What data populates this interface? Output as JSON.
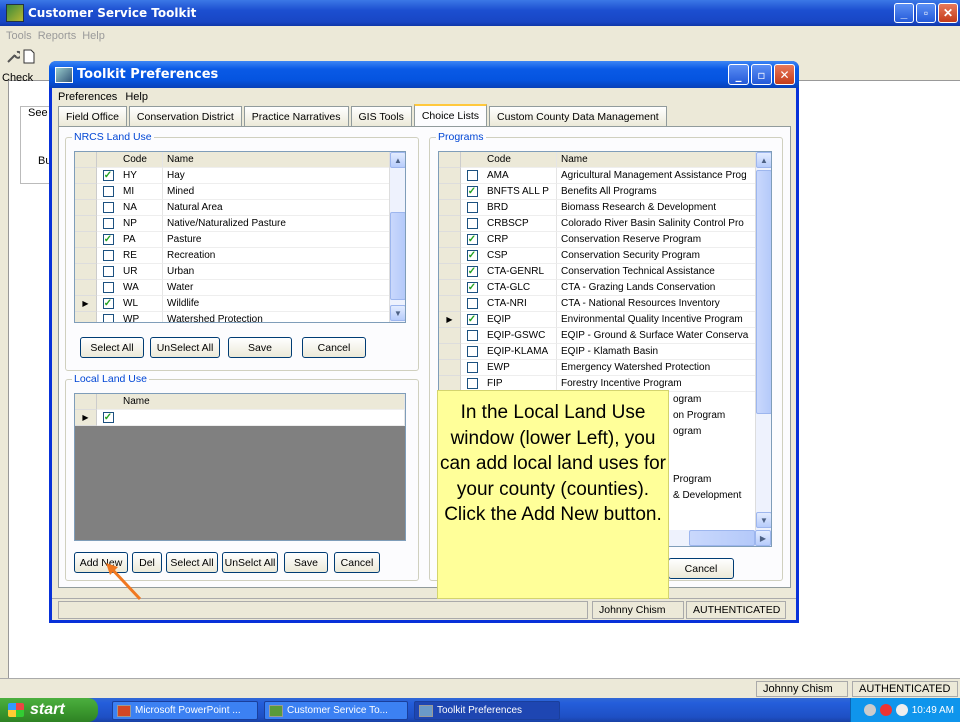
{
  "app": {
    "title": "Customer Service Toolkit",
    "menu": [
      "Tools",
      "Reports",
      "Help"
    ],
    "bg_fragments": {
      "check": "Check",
      "see": "See",
      "bu": "Bu"
    },
    "status_user": "Johnny Chism",
    "status_auth": "AUTHENTICATED"
  },
  "dialog": {
    "title": "Toolkit Preferences",
    "menu": [
      "Preferences",
      "Help"
    ],
    "tabs": [
      "Field Office",
      "Conservation District",
      "Practice Narratives",
      "GIS Tools",
      "Choice Lists",
      "Custom County Data Management"
    ],
    "active_tab": "Choice Lists",
    "nrcs": {
      "legend": "NRCS Land Use",
      "columns": [
        "Code",
        "Name"
      ],
      "rows": [
        {
          "checked": true,
          "code": "HY",
          "name": "Hay"
        },
        {
          "checked": false,
          "code": "MI",
          "name": "Mined"
        },
        {
          "checked": false,
          "code": "NA",
          "name": "Natural Area"
        },
        {
          "checked": false,
          "code": "NP",
          "name": "Native/Naturalized Pasture"
        },
        {
          "checked": true,
          "code": "PA",
          "name": "Pasture"
        },
        {
          "checked": false,
          "code": "RE",
          "name": "Recreation"
        },
        {
          "checked": false,
          "code": "UR",
          "name": "Urban"
        },
        {
          "checked": false,
          "code": "WA",
          "name": "Water"
        },
        {
          "checked": true,
          "code": "WL",
          "name": "Wildlife",
          "current": true
        },
        {
          "checked": false,
          "code": "WP",
          "name": "Watershed Protection"
        }
      ],
      "buttons": {
        "select_all": "Select All",
        "unselect_all": "UnSelect All",
        "save": "Save",
        "cancel": "Cancel"
      }
    },
    "local": {
      "legend": "Local Land Use",
      "columns": [
        "Name"
      ],
      "buttons": {
        "add_new": "Add New",
        "del": "Del",
        "select_all": "Select All",
        "unselect_all": "UnSelct All",
        "save": "Save",
        "cancel": "Cancel"
      }
    },
    "programs": {
      "legend": "Programs",
      "columns": [
        "Code",
        "Name"
      ],
      "rows": [
        {
          "checked": false,
          "code": "AMA",
          "name": "Agricultural Management Assistance Prog"
        },
        {
          "checked": true,
          "code": "BNFTS ALL P",
          "name": "Benefits All Programs"
        },
        {
          "checked": false,
          "code": "BRD",
          "name": "Biomass Research & Development"
        },
        {
          "checked": false,
          "code": "CRBSCP",
          "name": "Colorado River Basin Salinity Control Pro"
        },
        {
          "checked": true,
          "code": "CRP",
          "name": "Conservation Reserve Program"
        },
        {
          "checked": true,
          "code": "CSP",
          "name": "Conservation Security Program"
        },
        {
          "checked": true,
          "code": "CTA-GENRL",
          "name": "Conservation Technical Assistance"
        },
        {
          "checked": true,
          "code": "CTA-GLC",
          "name": "CTA - Grazing Lands Conservation"
        },
        {
          "checked": false,
          "code": "CTA-NRI",
          "name": "CTA - National Resources Inventory"
        },
        {
          "checked": true,
          "code": "EQIP",
          "name": "Environmental Quality Incentive Program",
          "current": true
        },
        {
          "checked": false,
          "code": "EQIP-GSWC",
          "name": "EQIP - Ground & Surface Water Conserva"
        },
        {
          "checked": false,
          "code": "EQIP-KLAMA",
          "name": "EQIP - Klamath Basin"
        },
        {
          "checked": false,
          "code": "EWP",
          "name": "Emergency Watershed Protection"
        },
        {
          "checked": false,
          "code": "FIP",
          "name": "Forestry Incentive Program"
        }
      ],
      "visible_fragments": [
        "ogram",
        "on Program",
        "ogram",
        "Program",
        "& Development"
      ],
      "cancel_label": "Cancel"
    },
    "status_user": "Johnny Chism",
    "status_auth": "AUTHENTICATED"
  },
  "callout": {
    "text": "In the Local Land Use window (lower Left), you can add local land uses for your county (counties).  Click the Add New button."
  },
  "taskbar": {
    "start": "start",
    "tasks": [
      "Microsoft PowerPoint ...",
      "Customer Service To...",
      "Toolkit Preferences"
    ],
    "clock": "10:49 AM"
  }
}
